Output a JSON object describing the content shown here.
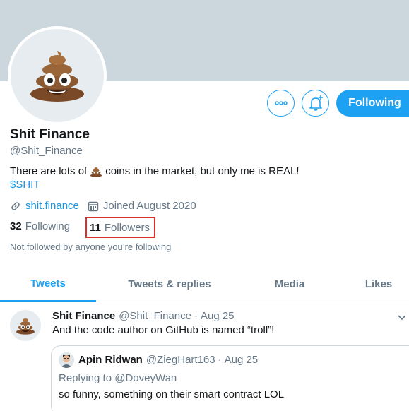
{
  "profile": {
    "name": "Shit Finance",
    "handle": "@Shit_Finance",
    "bio_before": "There are lots of",
    "bio_after": "coins in the market, but only me is REAL!",
    "cashtag": "$SHIT",
    "website": "shit.finance",
    "joined": "Joined August 2020",
    "following_count": "32",
    "following_label": "Following",
    "followers_count": "11",
    "followers_label": "Followers",
    "not_followed": "Not followed by anyone you’re following",
    "avatar_emoji": "poop-emoji-icon"
  },
  "actions": {
    "more_icon": "more-icon",
    "notify_icon": "bell-plus-icon",
    "following_label": "Following"
  },
  "tabs": [
    {
      "label": "Tweets",
      "active": true
    },
    {
      "label": "Tweets & replies",
      "active": false
    },
    {
      "label": "Media",
      "active": false
    },
    {
      "label": "Likes",
      "active": false
    }
  ],
  "tweet": {
    "name": "Shit Finance",
    "handle": "@Shit_Finance",
    "dot": "·",
    "date": "Aug 25",
    "text": "And the code author on GitHub is named “troll”!",
    "quote": {
      "name": "Apin Ridwan",
      "handle": "@ZiegHart163",
      "dot": "·",
      "date": "Aug 25",
      "replying_prefix": "Replying to",
      "replying_to": "@DoveyWan",
      "text": "so funny, something on their smart contract LOL"
    }
  },
  "colors": {
    "accent": "#1da1f2",
    "banner": "#ccd6dd",
    "highlight_box": "#d9302c",
    "muted": "#657786"
  }
}
